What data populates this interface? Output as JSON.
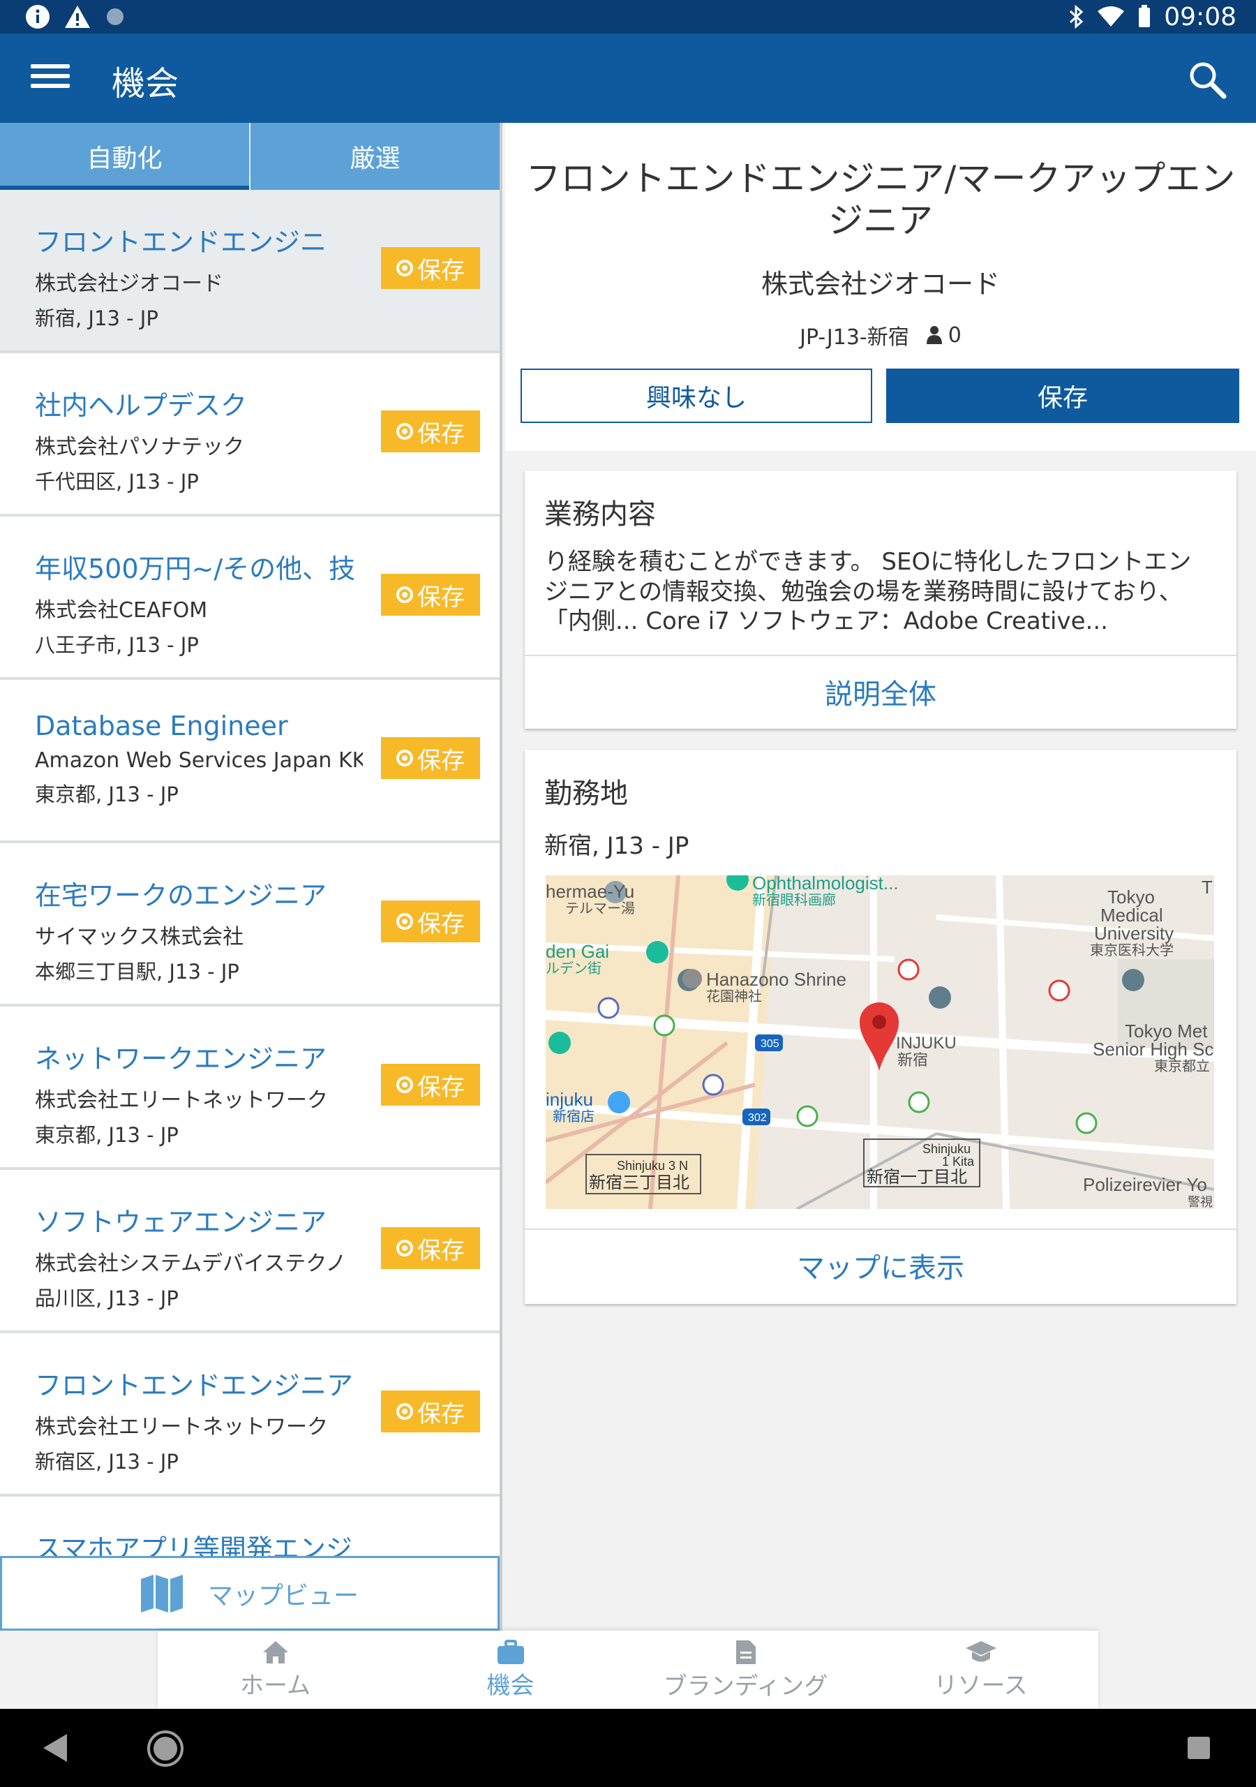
{
  "status_bar": {
    "time": "09:08"
  },
  "app_bar": {
    "title": "機会"
  },
  "tabs": [
    {
      "label": "自動化",
      "active": true
    },
    {
      "label": "厳選",
      "active": false
    }
  ],
  "save_label": "保存",
  "jobs": [
    {
      "title": "フロントエンドエンジニ",
      "company": "株式会社ジオコード",
      "location": "新宿, J13 - JP"
    },
    {
      "title": "社内ヘルプデスク",
      "company": "株式会社パソナテック",
      "location": "千代田区, J13 - JP"
    },
    {
      "title": "年収500万円~/その他、技",
      "company": "株式会社CEAFOM",
      "location": "八王子市, J13 - JP"
    },
    {
      "title": "Database Engineer",
      "company": "Amazon Web Services Japan KK",
      "location": "東京都, J13 - JP"
    },
    {
      "title": "在宅ワークのエンジニア",
      "company": "サイマックス株式会社",
      "location": "本郷三丁目駅, J13 - JP"
    },
    {
      "title": "ネットワークエンジニア",
      "company": "株式会社エリートネットワーク",
      "location": "東京都, J13 - JP"
    },
    {
      "title": "ソフトウェアエンジニア",
      "company": "株式会社システムデバイステクノ",
      "location": "品川区, J13 - JP"
    },
    {
      "title": "フロントエンドエンジニア",
      "company": "株式会社エリートネットワーク",
      "location": "新宿区, J13 - JP"
    },
    {
      "title": "スマホアプリ等開発エンジ",
      "company": "",
      "location": ""
    }
  ],
  "map_view_label": "マップビュー",
  "detail": {
    "title": "フロントエンドエンジニア/マークアップエンジニア",
    "company": "株式会社ジオコード",
    "location_code": "JP-J13-新宿",
    "applicants": "0",
    "not_interested_label": "興味なし",
    "save_label": "保存",
    "description": {
      "heading": "業務内容",
      "text": "り経験を積むことができます。 SEOに特化したフロントエンジニアとの情報交換、勉強会の場を業務時間に設けており、 「内側... Core i7 ソフトウェア：Adobe Creative...",
      "link": "説明全体"
    },
    "location": {
      "heading": "勤務地",
      "text": "新宿, J13 - JP",
      "link": "マップに表示"
    }
  },
  "map_labels": {
    "thermae": "hermae-Yu",
    "thermae_jp": "テルマー湯",
    "ophthal": "Ophthalmologist...",
    "ophthal_jp": "新宿眼科画廊",
    "tokyo_med_1": "Tokyo",
    "tokyo_med_2": "Medical",
    "tokyo_med_3": "University",
    "tokyo_med_jp": "東京医科大学",
    "den_gai": "den Gai",
    "den_gai_jp": "ルデン街",
    "hanazono": "Hanazono Shrine",
    "hanazono_jp": "花園神社",
    "shinjuku": "INJUKU",
    "shinjuku_jp": "新宿",
    "tokyo_met_1": "Tokyo Met",
    "tokyo_met_2": "Senior High Sc",
    "tokyo_met_jp": "東京都立",
    "injuku": "injuku",
    "injuku_jp": "新宿店",
    "road_305": "305",
    "road_302": "302",
    "shinjuku3n": "Shinjuku 3 N",
    "shinjuku3n_jp": "新宿三丁目北",
    "shinjuku1k_1": "Shinjuku",
    "shinjuku1k_2": "1 Kita",
    "shinjuku1k_jp": "新宿一丁目北",
    "polizei": "Polizeirevier Yo",
    "polizei_jp": "警視",
    "edge_t": "T"
  },
  "bottom_nav": [
    {
      "label": "ホーム",
      "icon": "home-icon"
    },
    {
      "label": "機会",
      "icon": "briefcase-icon",
      "active": true
    },
    {
      "label": "ブランディング",
      "icon": "document-icon"
    },
    {
      "label": "リソース",
      "icon": "graduation-cap-icon"
    }
  ]
}
